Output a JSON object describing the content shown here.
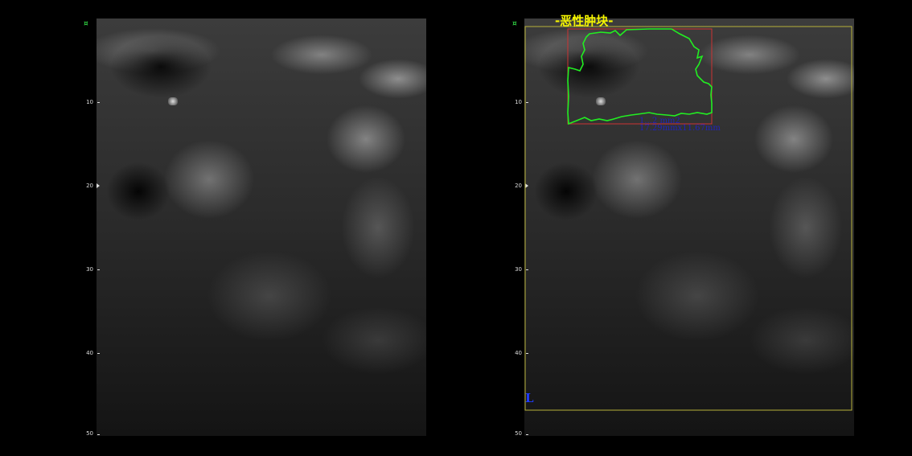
{
  "ruler": {
    "ticks": [
      "10",
      "20",
      "30",
      "40",
      "50"
    ]
  },
  "annotation": {
    "tumor_label": "-恶性肿块-",
    "measure_line_1": "1...2 mm2",
    "measure_line_2": "17.29mmx11.67mm",
    "side_letter": "L"
  },
  "colors": {
    "contour": "#22ee22",
    "bbox_red": "#cc3333",
    "roi_yellow": "#b7b13a",
    "label_yellow": "#f5f500",
    "measure_blue": "#2222bb"
  }
}
